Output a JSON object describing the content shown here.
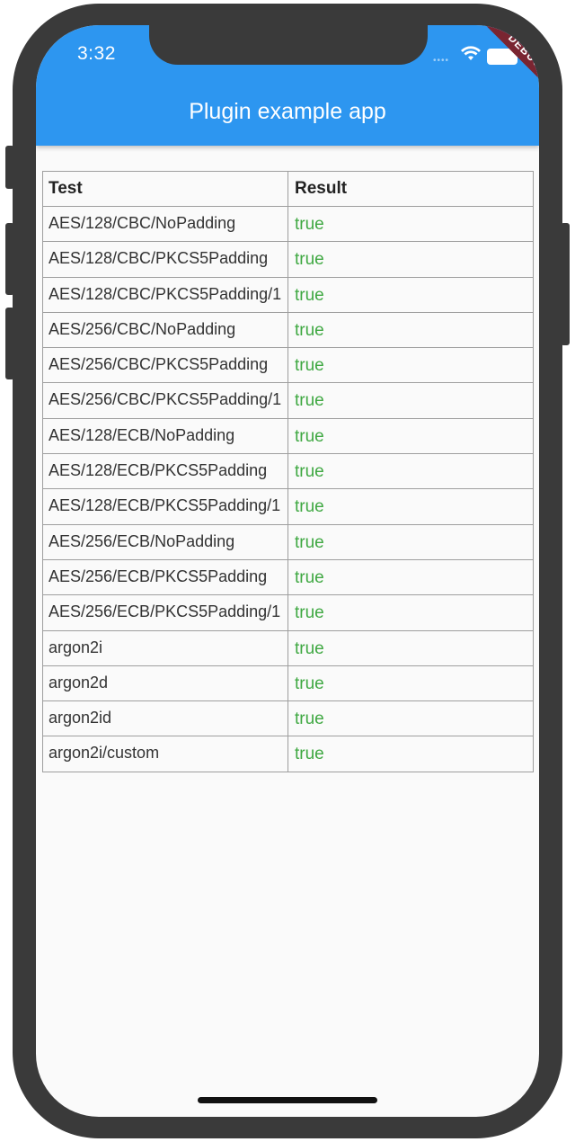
{
  "status_bar": {
    "time": "3:32",
    "debug_label": "DEBUG"
  },
  "appbar": {
    "title": "Plugin example app"
  },
  "table": {
    "headers": [
      "Test",
      "Result"
    ],
    "rows": [
      {
        "test": "AES/128/CBC/NoPadding",
        "result": "true"
      },
      {
        "test": "AES/128/CBC/PKCS5Padding",
        "result": "true"
      },
      {
        "test": "AES/128/CBC/PKCS5Padding/1",
        "result": "true"
      },
      {
        "test": "AES/256/CBC/NoPadding",
        "result": "true"
      },
      {
        "test": "AES/256/CBC/PKCS5Padding",
        "result": "true"
      },
      {
        "test": "AES/256/CBC/PKCS5Padding/1",
        "result": "true"
      },
      {
        "test": "AES/128/ECB/NoPadding",
        "result": "true"
      },
      {
        "test": "AES/128/ECB/PKCS5Padding",
        "result": "true"
      },
      {
        "test": "AES/128/ECB/PKCS5Padding/1",
        "result": "true"
      },
      {
        "test": "AES/256/ECB/NoPadding",
        "result": "true"
      },
      {
        "test": "AES/256/ECB/PKCS5Padding",
        "result": "true"
      },
      {
        "test": "AES/256/ECB/PKCS5Padding/1",
        "result": "true"
      },
      {
        "test": "argon2i",
        "result": "true"
      },
      {
        "test": "argon2d",
        "result": "true"
      },
      {
        "test": "argon2id",
        "result": "true"
      },
      {
        "test": "argon2i/custom",
        "result": "true"
      }
    ]
  },
  "colors": {
    "appbar": "#2d96f0",
    "result_true": "#3fa842",
    "debug_ribbon": "#7a2531"
  }
}
